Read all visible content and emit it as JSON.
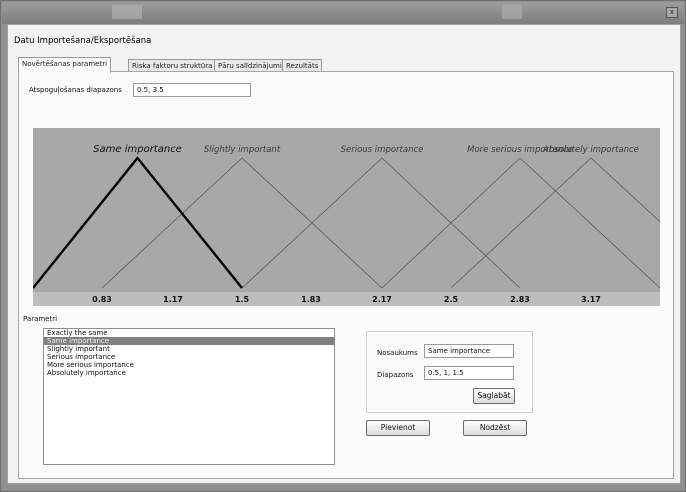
{
  "window": {
    "title": "Datu Importešana/Eksportēšana",
    "close_glyph": "x"
  },
  "tabs": [
    {
      "label": "Novērtēšanas parametri",
      "active": true
    },
    {
      "label": "Riska faktoru struktūra",
      "active": false
    },
    {
      "label": "Pāru salīdzinājumi",
      "active": false
    },
    {
      "label": "Rezultāts",
      "active": false
    }
  ],
  "range": {
    "label": "Atspoguļošanas diapazons",
    "value": "0.5, 3.5"
  },
  "chart_data": {
    "type": "line",
    "xlim": [
      0.5,
      3.5
    ],
    "ylim": [
      0,
      1
    ],
    "tick_labels": [
      "0.83",
      "1.17",
      "1.5",
      "1.83",
      "2.17",
      "2.5",
      "2.83",
      "3.17"
    ],
    "tick_values": [
      0.83,
      1.17,
      1.5,
      1.83,
      2.17,
      2.5,
      2.83,
      3.17
    ],
    "colors": {
      "background": "#a8a8a8",
      "line": "#5a5a5a",
      "highlight": "#000000"
    },
    "series": [
      {
        "name": "Same importance",
        "points": [
          [
            0.5,
            0
          ],
          [
            1.0,
            1
          ],
          [
            1.5,
            0
          ]
        ],
        "highlighted": true
      },
      {
        "name": "Slightly important",
        "points": [
          [
            0.83,
            0
          ],
          [
            1.5,
            1
          ],
          [
            2.17,
            0
          ]
        ],
        "highlighted": false
      },
      {
        "name": "Serious importance",
        "points": [
          [
            1.5,
            0
          ],
          [
            2.17,
            1
          ],
          [
            2.83,
            0
          ]
        ],
        "highlighted": false
      },
      {
        "name": "More serious importance",
        "points": [
          [
            2.17,
            0
          ],
          [
            2.83,
            1
          ],
          [
            3.5,
            0
          ]
        ],
        "highlighted": false
      },
      {
        "name": "Absolutely importance",
        "points": [
          [
            2.5,
            0
          ],
          [
            3.17,
            1
          ],
          [
            3.5,
            0.51
          ]
        ],
        "highlighted": false
      }
    ]
  },
  "parameters": {
    "label": "Parametri",
    "items": [
      "Exactly the same",
      "Same importance",
      "Slightly important",
      "Serious importance",
      "More serious importance",
      "Absolutely importance"
    ],
    "selected_index": 1
  },
  "details": {
    "name_label": "Nosaukums",
    "name_value": "Same importance",
    "range_label": "Diapazons",
    "range_value": "0.5, 1, 1.5",
    "save_button": "Saglabāt"
  },
  "actions": {
    "add_button": "Pievienot",
    "delete_button": "Nodzēst"
  }
}
